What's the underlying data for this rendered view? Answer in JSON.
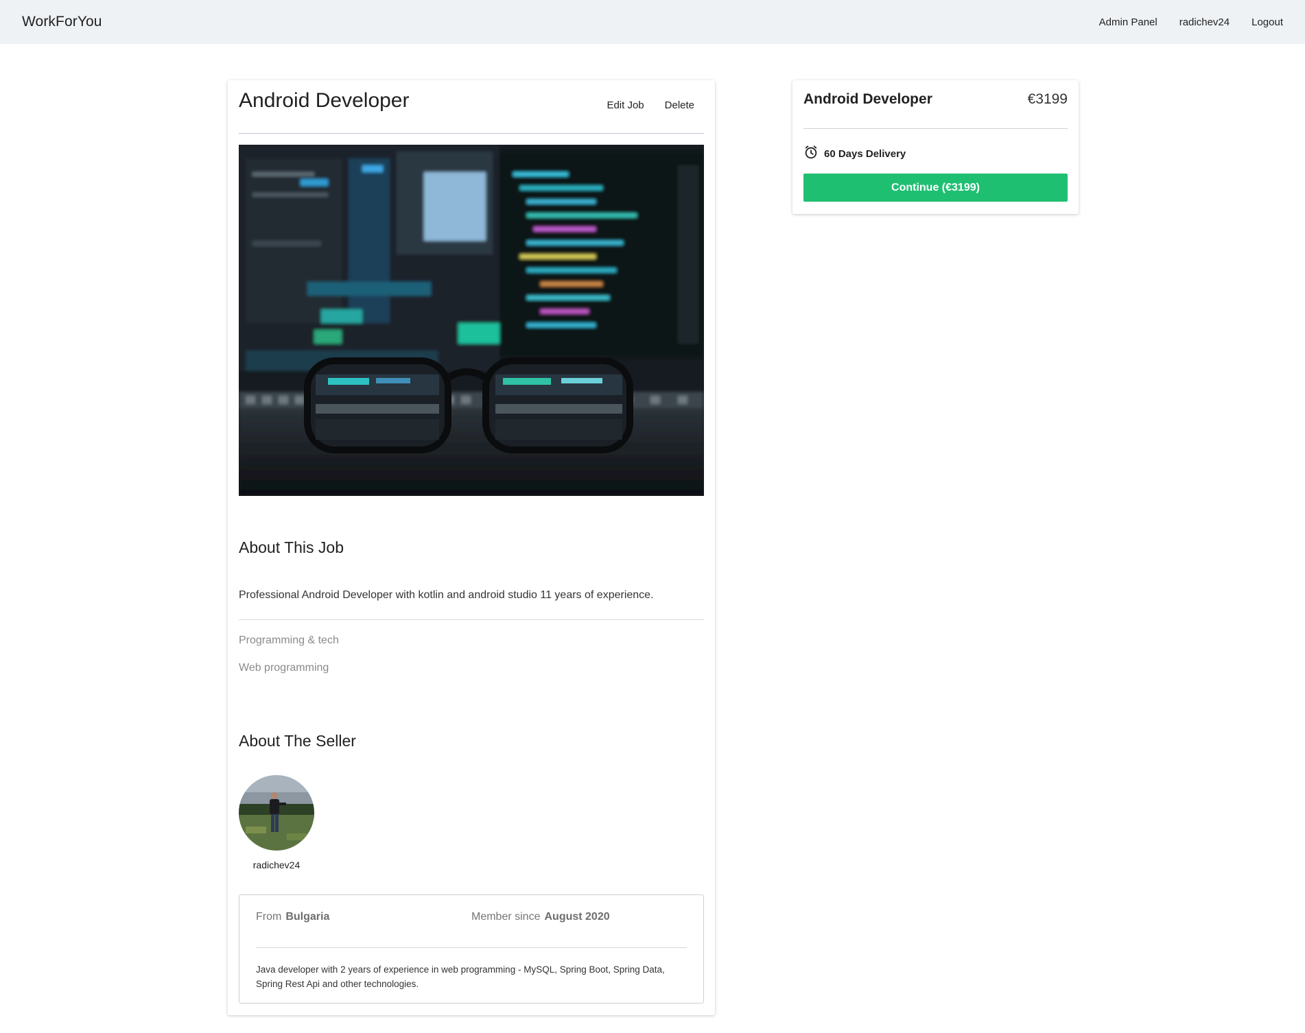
{
  "navbar": {
    "brand": "WorkForYou",
    "links": [
      "Admin Panel",
      "radichev24",
      "Logout"
    ]
  },
  "job": {
    "title": "Android Developer",
    "edit_label": "Edit Job",
    "delete_label": "Delete",
    "about_heading": "About This Job",
    "description": "Professional Android Developer with kotlin and android studio 11 years of experience.",
    "category": "Programming & tech",
    "subcategory": "Web programming"
  },
  "seller": {
    "heading": "About The Seller",
    "username": "radichev24",
    "from_label": "From",
    "country": "Bulgaria",
    "member_label": "Member since",
    "member_since": "August 2020",
    "bio": "Java developer with 2 years of experience in web programming - MySQL, Spring Boot, Spring Data, Spring Rest Api and other technologies."
  },
  "order": {
    "title": "Android Developer",
    "price": "€3199",
    "delivery": "60 Days Delivery",
    "continue_label": "Continue (€3199)",
    "accent_color": "#1fbf72"
  },
  "icons": {
    "delivery": "alarm-clock-icon"
  }
}
